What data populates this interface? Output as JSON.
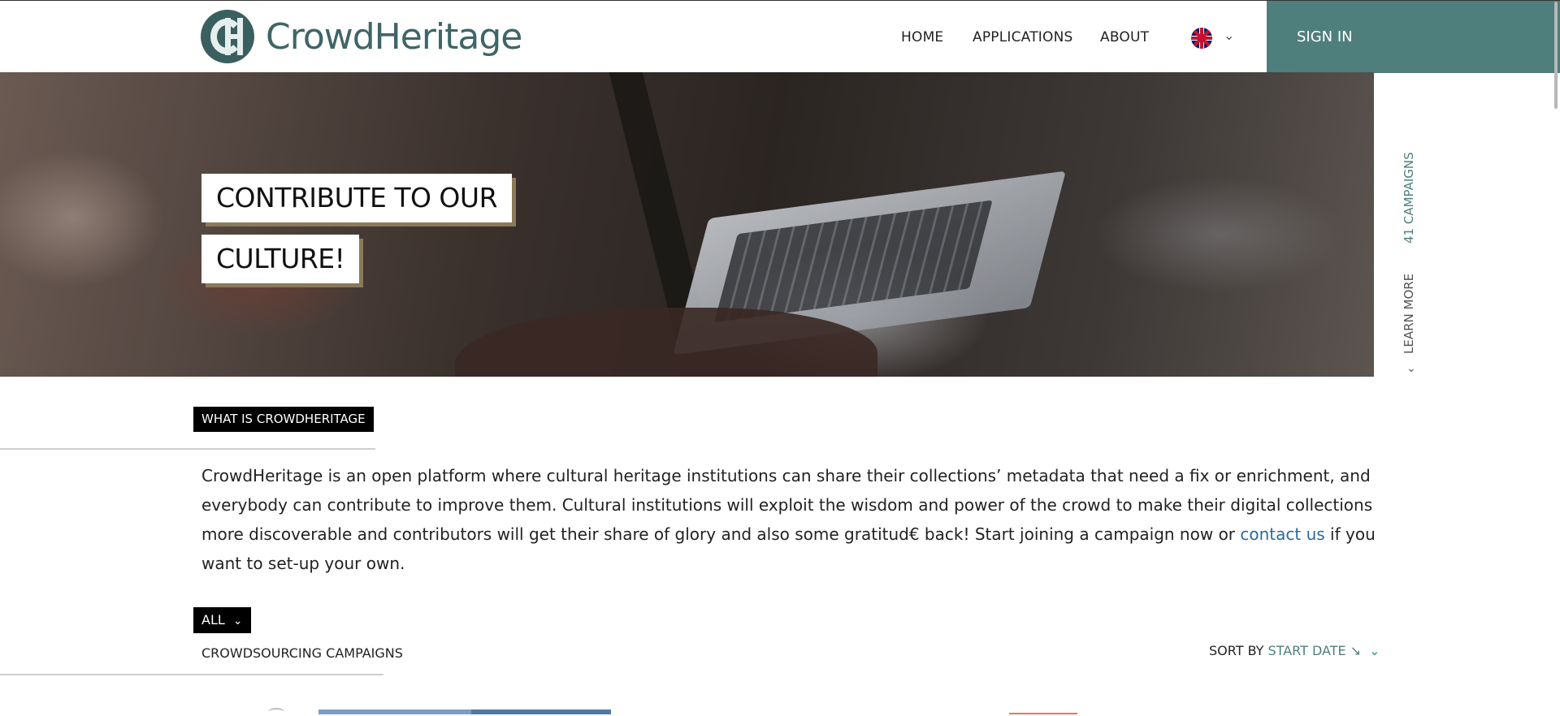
{
  "header": {
    "logo_text": "CrowdHeritage",
    "nav": {
      "home": "HOME",
      "applications": "APPLICATIONS",
      "about": "ABOUT"
    },
    "language": "English",
    "sign_in": "SIGN IN"
  },
  "hero": {
    "line1": "CONTRIBUTE TO OUR",
    "line2": "CULTURE!"
  },
  "side": {
    "campaigns": "41 CAMPAIGNS",
    "learn_more": "LEARN MORE"
  },
  "about": {
    "tag": "WHAT IS CROWDHERITAGE",
    "text_before": "CrowdHeritage is an open platform where cultural heritage institutions can share their collections’ metadata that need a fix or enrichment, and everybody can contribute to improve them. Cultural institutions will exploit the wisdom and power of the crowd to make their digital collections more discoverable and contributors will get their share of glory and also some gratitud€ back! Start joining a campaign now or ",
    "link": "contact us",
    "text_after": " if you want to set-up your own."
  },
  "filter": {
    "selected": "ALL",
    "section_label": "CROWDSOURCING CAMPAIGNS"
  },
  "sort": {
    "label": "SORT BY",
    "value": "START DATE ↘"
  },
  "colors": {
    "accent": "#4e7f7c",
    "link": "#2a6aa0"
  }
}
